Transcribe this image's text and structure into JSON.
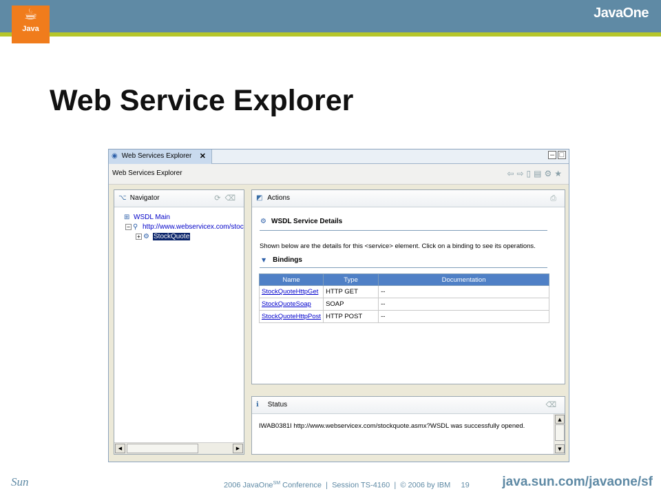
{
  "slide": {
    "title": "Web Service Explorer",
    "java_logo_text": "Java",
    "javaone_logo": "JavaOne",
    "sun_logo": "Sun",
    "footer": {
      "conference": "2006 JavaOne",
      "sm": "SM",
      "rest": " Conference  |  Session TS-4160  |  © 2006 by IBM     19",
      "url": "java.sun.com/javaone/sf"
    }
  },
  "window": {
    "tab_label": "Web Services Explorer",
    "subbar_title": "Web Services Explorer",
    "toolbar_icons": [
      "back-arrow-icon",
      "forward-arrow-icon",
      "page-icon",
      "page-search-icon",
      "uddi-icon",
      "favorite-star-icon"
    ]
  },
  "navigator": {
    "title": "Navigator",
    "tree": [
      {
        "label": "WSDL Main",
        "level": 0
      },
      {
        "label": "http://www.webservicex.com/stockquote.asmx?WSDL",
        "level": 1
      },
      {
        "label": "StockQuote",
        "level": 2,
        "selected": true
      }
    ]
  },
  "actions": {
    "title": "Actions",
    "section_title": "WSDL Service Details",
    "description": "Shown below are the details for this <service> element. Click on a binding to see its operations.",
    "bindings_title": "Bindings",
    "columns": [
      "Name",
      "Type",
      "Documentation"
    ],
    "rows": [
      {
        "name": "StockQuoteHttpGet",
        "type": "HTTP GET",
        "doc": "--"
      },
      {
        "name": "StockQuoteSoap",
        "type": "SOAP",
        "doc": "--"
      },
      {
        "name": "StockQuoteHttpPost",
        "type": "HTTP POST",
        "doc": "--"
      }
    ]
  },
  "status": {
    "title": "Status",
    "message": "IWAB0381I http://www.webservicex.com/stockquote.asmx?WSDL was successfully opened."
  }
}
